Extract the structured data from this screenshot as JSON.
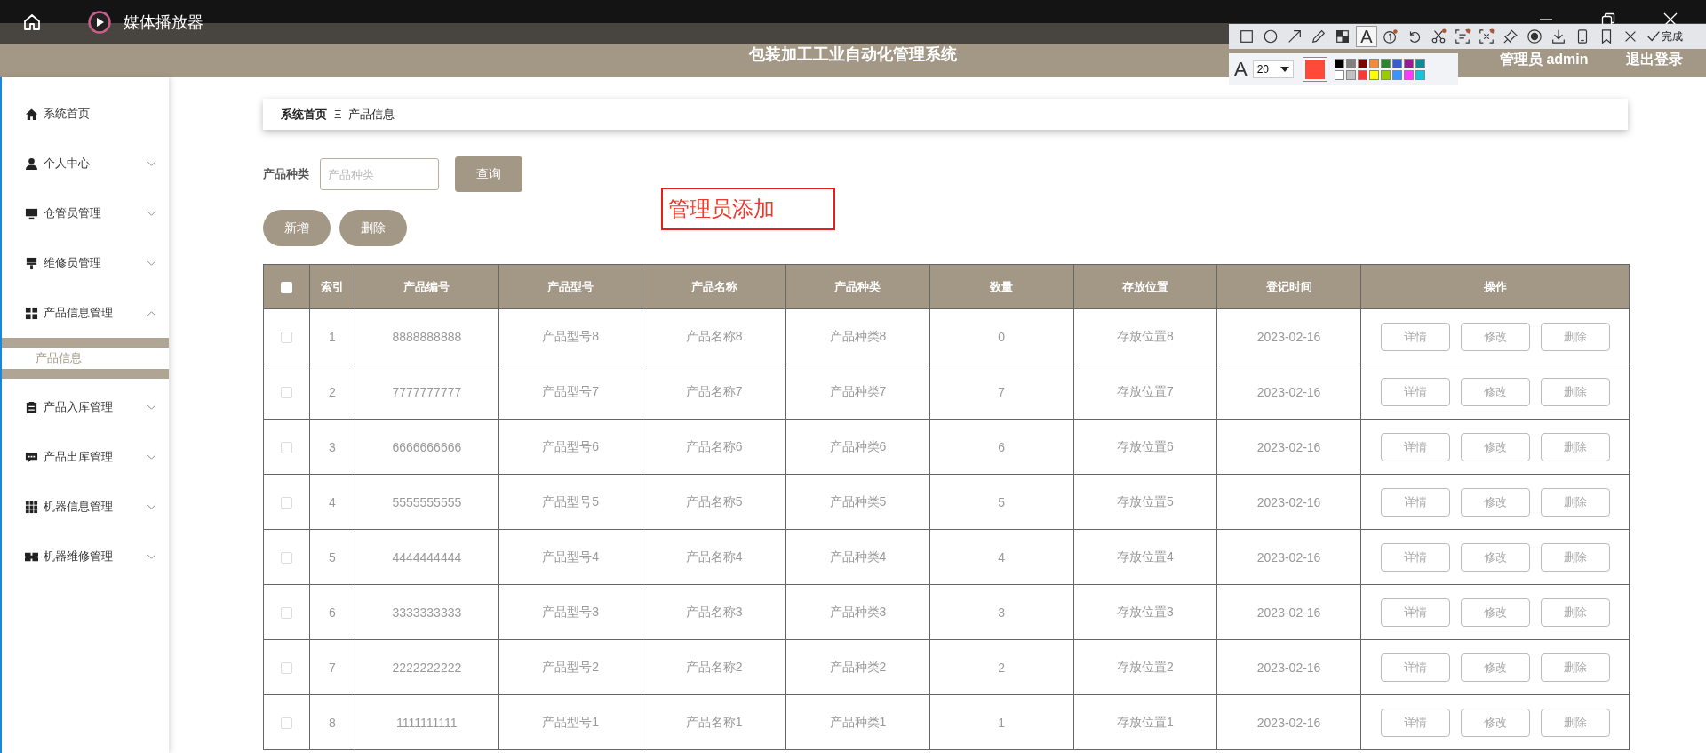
{
  "player": {
    "title": "媒体播放器"
  },
  "app": {
    "title": "包装加工工业自动化管理系统",
    "user": "管理员 admin",
    "logout": "退出登录"
  },
  "sidebar": {
    "items": [
      {
        "label": "系统首页",
        "kind": "link"
      },
      {
        "label": "个人中心",
        "kind": "menu",
        "expanded": false
      },
      {
        "label": "仓管员管理",
        "kind": "menu",
        "expanded": false
      },
      {
        "label": "维修员管理",
        "kind": "menu",
        "expanded": false
      },
      {
        "label": "产品信息管理",
        "kind": "menu",
        "expanded": true,
        "children": [
          {
            "label": "产品信息",
            "selected": true
          }
        ]
      },
      {
        "label": "产品入库管理",
        "kind": "menu",
        "expanded": false
      },
      {
        "label": "产品出库管理",
        "kind": "menu",
        "expanded": false
      },
      {
        "label": "机器信息管理",
        "kind": "menu",
        "expanded": false
      },
      {
        "label": "机器维修管理",
        "kind": "menu",
        "expanded": false
      }
    ]
  },
  "breadcrumb": {
    "items": [
      "系统首页",
      "产品信息"
    ],
    "separator": "Ξ"
  },
  "search": {
    "label": "产品种类",
    "placeholder": "产品种类",
    "button": "查询"
  },
  "actions": [
    "新增",
    "删除"
  ],
  "annotation": {
    "text": "管理员添加"
  },
  "table": {
    "header_checked": false,
    "columns": [
      "索引",
      "产品编号",
      "产品型号",
      "产品名称",
      "产品种类",
      "数量",
      "存放位置",
      "登记时间",
      "操作"
    ],
    "rows": [
      {
        "checked": false,
        "cells": [
          "1",
          "8888888888",
          "产品型号8",
          "产品名称8",
          "产品种类8",
          "0",
          "存放位置8",
          "2023-02-16"
        ],
        "actions": [
          "详情",
          "修改",
          "删除"
        ]
      },
      {
        "checked": false,
        "cells": [
          "2",
          "7777777777",
          "产品型号7",
          "产品名称7",
          "产品种类7",
          "7",
          "存放位置7",
          "2023-02-16"
        ],
        "actions": [
          "详情",
          "修改",
          "删除"
        ]
      },
      {
        "checked": false,
        "cells": [
          "3",
          "6666666666",
          "产品型号6",
          "产品名称6",
          "产品种类6",
          "6",
          "存放位置6",
          "2023-02-16"
        ],
        "actions": [
          "详情",
          "修改",
          "删除"
        ]
      },
      {
        "checked": false,
        "cells": [
          "4",
          "5555555555",
          "产品型号5",
          "产品名称5",
          "产品种类5",
          "5",
          "存放位置5",
          "2023-02-16"
        ],
        "actions": [
          "详情",
          "修改",
          "删除"
        ]
      },
      {
        "checked": false,
        "cells": [
          "5",
          "4444444444",
          "产品型号4",
          "产品名称4",
          "产品种类4",
          "4",
          "存放位置4",
          "2023-02-16"
        ],
        "actions": [
          "详情",
          "修改",
          "删除"
        ]
      },
      {
        "checked": false,
        "cells": [
          "6",
          "3333333333",
          "产品型号3",
          "产品名称3",
          "产品种类3",
          "3",
          "存放位置3",
          "2023-02-16"
        ],
        "actions": [
          "详情",
          "修改",
          "删除"
        ]
      },
      {
        "checked": false,
        "cells": [
          "7",
          "2222222222",
          "产品型号2",
          "产品名称2",
          "产品种类2",
          "2",
          "存放位置2",
          "2023-02-16"
        ],
        "actions": [
          "详情",
          "修改",
          "删除"
        ]
      },
      {
        "checked": false,
        "cells": [
          "8",
          "1111111111",
          "产品型号1",
          "产品名称1",
          "产品种类1",
          "1",
          "存放位置1",
          "2023-02-16"
        ],
        "actions": [
          "详情",
          "修改",
          "删除"
        ]
      }
    ]
  },
  "screenshot_toolbar": {
    "tools": [
      {
        "kind": "rect",
        "selected": false
      },
      {
        "kind": "ellipse",
        "selected": false
      },
      {
        "kind": "arrow",
        "selected": false
      },
      {
        "kind": "pencil",
        "selected": false
      },
      {
        "kind": "mosaic",
        "selected": false
      },
      {
        "kind": "text",
        "label": "A",
        "selected": true
      },
      {
        "kind": "number",
        "selected": false
      },
      {
        "kind": "undo",
        "selected": false
      },
      {
        "kind": "scissors",
        "selected": false
      },
      {
        "kind": "ocr",
        "selected": false
      },
      {
        "kind": "translate",
        "selected": false
      },
      {
        "kind": "pin",
        "selected": false
      },
      {
        "kind": "record",
        "selected": false
      },
      {
        "kind": "download",
        "selected": false
      },
      {
        "kind": "phone",
        "selected": false
      },
      {
        "kind": "bookmark",
        "selected": false
      },
      {
        "kind": "close",
        "selected": false
      }
    ],
    "done": "完成",
    "font_label": "A",
    "font_size": "20",
    "palette": [
      {
        "color": "#000000"
      },
      {
        "color": "#808080"
      },
      {
        "color": "#800000"
      },
      {
        "color": "#f7883a"
      },
      {
        "color": "#308430"
      },
      {
        "color": "#385ad3"
      },
      {
        "color": "#9b1b96"
      },
      {
        "color": "#0e8a99"
      },
      {
        "color": "#ffffff"
      },
      {
        "color": "#c0c0c0"
      },
      {
        "color": "#fb3838"
      },
      {
        "color": "#ffff00"
      },
      {
        "color": "#99cc00"
      },
      {
        "color": "#3895ff"
      },
      {
        "color": "#ff38ff"
      },
      {
        "color": "#16c6d8"
      }
    ]
  }
}
